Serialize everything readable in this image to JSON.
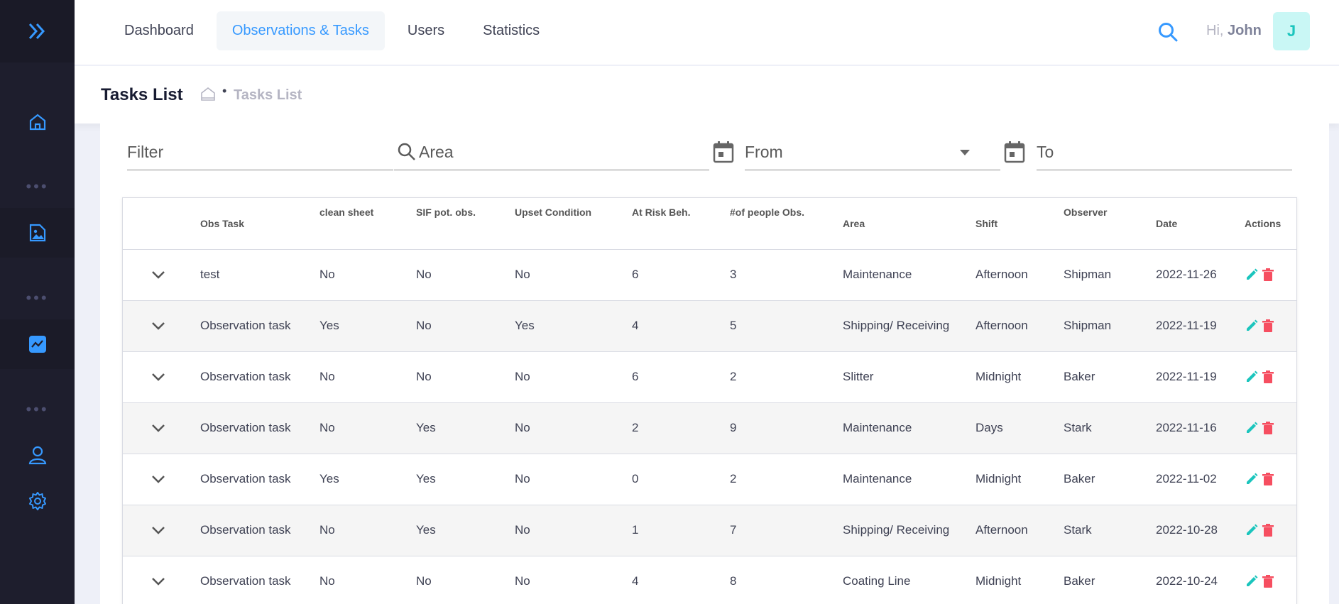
{
  "colors": {
    "accent": "#3699ff",
    "sidebar": "#1e1e2d",
    "edit": "#1bc5bd",
    "delete": "#f64e60"
  },
  "sidebar": {
    "items": [
      {
        "name": "home-icon"
      },
      {
        "name": "document-image-icon"
      },
      {
        "name": "chart-icon"
      },
      {
        "name": "user-icon"
      },
      {
        "name": "gear-icon"
      }
    ]
  },
  "topnav": {
    "items": [
      "Dashboard",
      "Observations & Tasks",
      "Users",
      "Statistics"
    ],
    "active": "Observations & Tasks"
  },
  "user": {
    "greeting": "Hi,",
    "name": "John",
    "initial": "J"
  },
  "subheader": {
    "title": "Tasks List",
    "breadcrumb": "Tasks List"
  },
  "filters": {
    "filter": "Filter",
    "area": "Area",
    "from": "From",
    "to": "To"
  },
  "table": {
    "headers": [
      "Obs Task",
      "clean sheet",
      "SIF pot. obs.",
      "Upset Condition",
      "At Risk Beh.",
      "#of people Obs.",
      "Area",
      "Shift",
      "Observer",
      "Date",
      "Actions"
    ],
    "rows": [
      [
        "test",
        "No",
        "No",
        "No",
        "6",
        "3",
        "Maintenance",
        "Afternoon",
        "Shipman",
        "2022-11-26"
      ],
      [
        "Observation task",
        "Yes",
        "No",
        "Yes",
        "4",
        "5",
        "Shipping/ Receiving",
        "Afternoon",
        "Shipman",
        "2022-11-19"
      ],
      [
        "Observation task",
        "No",
        "No",
        "No",
        "6",
        "2",
        "Slitter",
        "Midnight",
        "Baker",
        "2022-11-19"
      ],
      [
        "Observation task",
        "No",
        "Yes",
        "No",
        "2",
        "9",
        "Maintenance",
        "Days",
        "Stark",
        "2022-11-16"
      ],
      [
        "Observation task",
        "Yes",
        "Yes",
        "No",
        "0",
        "2",
        "Maintenance",
        "Midnight",
        "Baker",
        "2022-11-02"
      ],
      [
        "Observation task",
        "No",
        "Yes",
        "No",
        "1",
        "7",
        "Shipping/ Receiving",
        "Afternoon",
        "Stark",
        "2022-10-28"
      ],
      [
        "Observation task",
        "No",
        "No",
        "No",
        "4",
        "8",
        "Coating Line",
        "Midnight",
        "Baker",
        "2022-10-24"
      ]
    ]
  }
}
